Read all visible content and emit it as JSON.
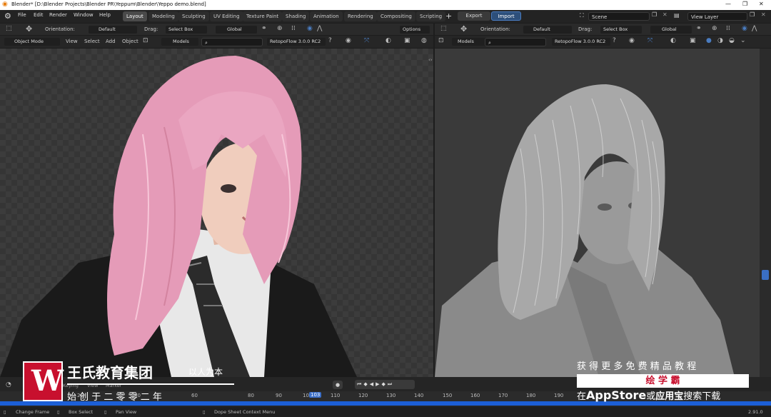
{
  "window": {
    "title": "Blender* [D:\\Blender Projects\\Blender PR\\Yeppum\\Blender\\Yeppo demo.blend]"
  },
  "menu": [
    "File",
    "Edit",
    "Render",
    "Window",
    "Help"
  ],
  "workspaces": [
    "Layout",
    "Modeling",
    "Sculpting",
    "UV Editing",
    "Texture Paint",
    "Shading",
    "Animation",
    "Rendering",
    "Compositing",
    "Scripting"
  ],
  "header_right": {
    "export_label": "Export",
    "import_label": "Import",
    "scene_value": "Scene",
    "view_layer_value": "View Layer"
  },
  "tool_header": {
    "orientation_label": "Orientation:",
    "orientation_value": "Default",
    "drag_label": "Drag:",
    "drag_value": "Select Box",
    "global_value": "Global",
    "options_label": "Options"
  },
  "viewport_header": {
    "mode_value": "Object Mode",
    "view_label": "View",
    "select_label": "Select",
    "add_label": "Add",
    "object_label": "Object",
    "models_value": "Models",
    "retopo_value": "RetopoFlow 3.0.0 RC2"
  },
  "timeline": {
    "menu": [
      "Keying",
      "View",
      "Marker"
    ],
    "current_frame": "103",
    "ticks": [
      "20",
      "40",
      "60",
      "80",
      "90",
      "100",
      "110",
      "120",
      "130",
      "140",
      "150",
      "160",
      "170",
      "180",
      "190"
    ]
  },
  "status_bar": {
    "items": [
      "Change Frame",
      "Box Select",
      "Pan View",
      "Dope Sheet Context Menu"
    ],
    "version": "2.91.0"
  },
  "watermark": {
    "logo_letter": "W",
    "company": "王氏教育集团",
    "slogan": "以人为本",
    "since": "始 创 于 二 零 零 二 年",
    "promo_line1": "获 得 更 多 免 费 精 品 教 程",
    "promo_brand": "绘 学 霸",
    "promo_line2_a": "在",
    "promo_line2_b": "AppStore",
    "promo_line2_c": "或",
    "promo_line2_d": "应用宝",
    "promo_line2_e": "搜索下载"
  },
  "colors": {
    "accent_blue": "#1c5fd6",
    "brand_red": "#c8102e",
    "hair_pink": "#e59bb8"
  }
}
